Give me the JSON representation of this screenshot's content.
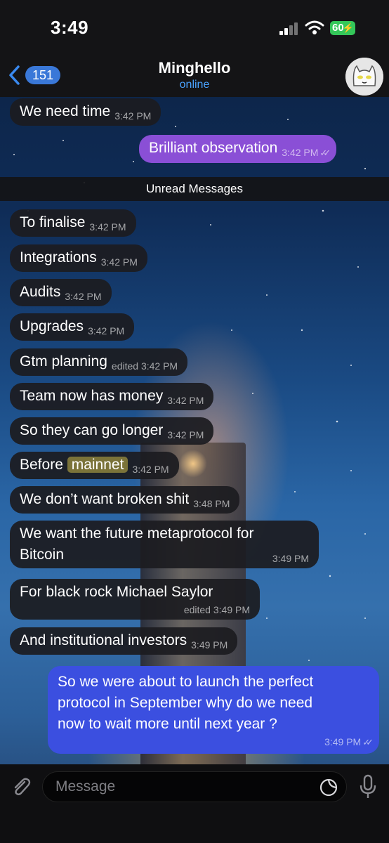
{
  "status_bar": {
    "time": "3:49",
    "battery": "60"
  },
  "header": {
    "back_count": "151",
    "title": "Minghello",
    "status": "online"
  },
  "divider": "Unread Messages",
  "messages": [
    {
      "text": "We need time",
      "time": "3:42 PM"
    },
    {
      "text": "Brilliant observation",
      "time": "3:42 PM"
    },
    {
      "text": "To finalise",
      "time": "3:42 PM"
    },
    {
      "text": "Integrations",
      "time": "3:42 PM"
    },
    {
      "text": "Audits",
      "time": "3:42 PM"
    },
    {
      "text": "Upgrades",
      "time": "3:42 PM"
    },
    {
      "text": "Gtm planning",
      "time": "edited 3:42 PM"
    },
    {
      "text": "Team now has money",
      "time": "3:42 PM"
    },
    {
      "text": "So they can go longer",
      "time": "3:42 PM"
    },
    {
      "text": "Before",
      "highlight": "mainnet",
      "time": "3:42 PM"
    },
    {
      "text": "We don’t want broken shit",
      "time": "3:48 PM"
    },
    {
      "line1": "We want the future metaprotocol for",
      "line2": "Bitcoin",
      "time": "3:49 PM"
    },
    {
      "text": "For black rock Michael Saylor",
      "time": "edited 3:49 PM"
    },
    {
      "text": "And institutional investors",
      "time": "3:49 PM"
    },
    {
      "line1": "So we were about to launch the perfect",
      "line2": "protocol in September why do we need",
      "line3": "now to wait more until next year ?",
      "time": "3:49 PM"
    }
  ],
  "input": {
    "placeholder": "Message"
  },
  "colors": {
    "incoming_bubble": "#1c1c20",
    "outgoing_purple": "#8a4fd6",
    "outgoing_blue": "#3b4fe0",
    "accent": "#3a78d8",
    "online": "#4aa3ff"
  },
  "icons": [
    "back-chevron-icon",
    "signal-icon",
    "wifi-icon",
    "battery-icon",
    "attach-icon",
    "sticker-icon",
    "mic-icon",
    "read-checks-icon"
  ]
}
